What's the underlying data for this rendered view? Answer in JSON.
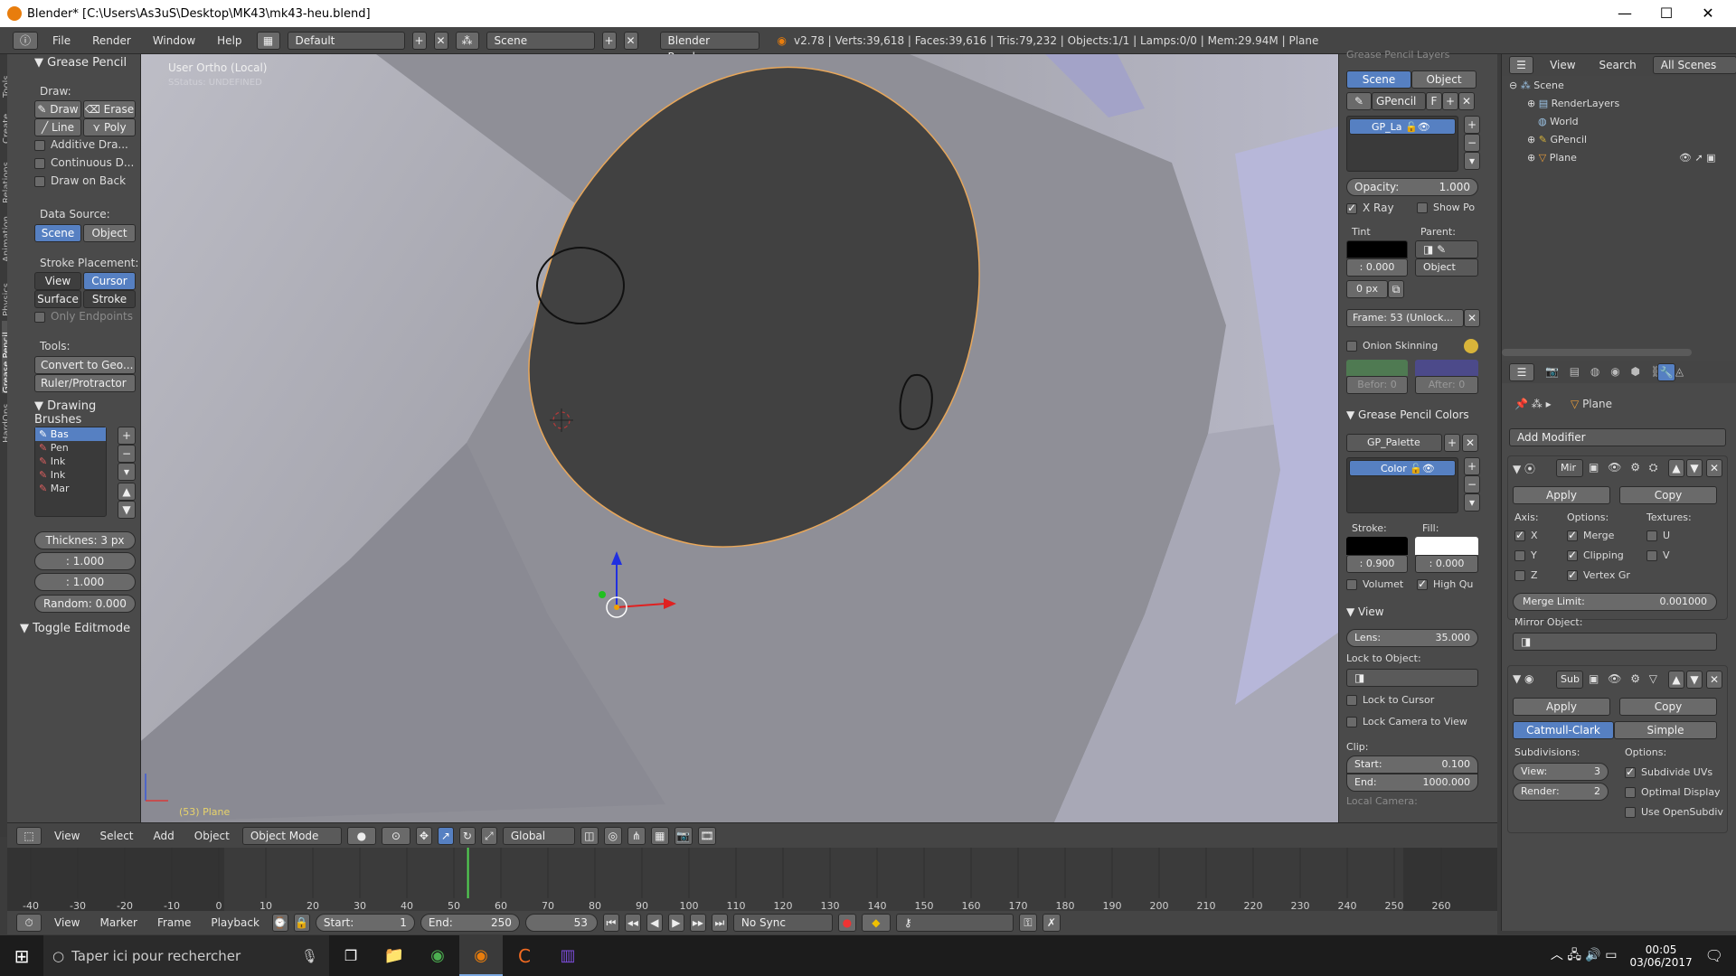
{
  "window": {
    "title": "Blender* [C:\\Users\\As3uS\\Desktop\\MK43\\mk43-heu.blend]",
    "minimize": "—",
    "maximize": "☐",
    "close": "✕"
  },
  "infobar": {
    "menus": [
      "File",
      "Render",
      "Window",
      "Help"
    ],
    "layout": "Default",
    "scene": "Scene",
    "engine": "Blender Render",
    "stats": "v2.78 | Verts:39,618 | Faces:39,616 | Tris:79,232 | Objects:1/1 | Lamps:0/0 | Mem:29.94M | Plane"
  },
  "tool_tabs": [
    "Tools",
    "Create",
    "Relations",
    "Animation",
    "Physics",
    "Grease Pencil",
    "HardOps"
  ],
  "toolshelf": {
    "panel_title": "Grease Pencil",
    "draw_label": "Draw:",
    "draw": "Draw",
    "erase": "Erase",
    "line": "Line",
    "poly": "Poly",
    "additive": "Additive Dra...",
    "continuous": "Continuous D...",
    "draw_on_back": "Draw on Back",
    "data_source_label": "Data Source:",
    "ds_scene": "Scene",
    "ds_object": "Object",
    "stroke_placement_label": "Stroke Placement:",
    "sp_view": "View",
    "sp_cursor": "Cursor",
    "sp_surface": "Surface",
    "sp_stroke": "Stroke",
    "only_endpoints": "Only Endpoints",
    "tools_label": "Tools:",
    "convert": "Convert to Geo...",
    "ruler": "Ruler/Protractor",
    "brushes_title": "Drawing Brushes",
    "brushes": [
      "Bas",
      "Pen",
      "Ink",
      "Ink",
      "Mar"
    ],
    "thickness": "Thicknes: 3 px",
    "strength1": ": 1.000",
    "strength2": ": 1.000",
    "random": "Random: 0.000",
    "toggle_editmode": "Toggle Editmode"
  },
  "viewport": {
    "view_name": "User Ortho (Local)",
    "status": "SStatus: UNDEFINED",
    "object_label": "(53) Plane"
  },
  "npanel": {
    "layers_title": "Grease Pencil Layers",
    "scene": "Scene",
    "object": "Object",
    "gpencil": "GPencil",
    "f": "F",
    "layer": "GP_La",
    "opacity": "Opacity:",
    "opacity_val": "1.000",
    "xray": "X Ray",
    "show_po": "Show Po",
    "tint": "Tint",
    "parent": "Parent:",
    "tint_val": ": 0.000",
    "parent_type": "Object",
    "px": "0 px",
    "frame": "Frame: 53 (Unlock...",
    "onion": "Onion Skinning",
    "before": "Befor: 0",
    "after": "After: 0",
    "colors_title": "Grease Pencil Colors",
    "palette": "GP_Palette",
    "color": "Color",
    "stroke": "Stroke:",
    "fill": "Fill:",
    "stroke_val": ": 0.900",
    "fill_val": ": 0.000",
    "volumet": "Volumet",
    "high_qu": "High Qu",
    "view_title": "View",
    "lens": "Lens:",
    "lens_val": "35.000",
    "lock_obj": "Lock to Object:",
    "lock_cursor": "Lock to Cursor",
    "lock_camera": "Lock Camera to View",
    "clip": "Clip:",
    "clip_start": "Start:",
    "clip_start_val": "0.100",
    "clip_end": "End:",
    "clip_end_val": "1000.000",
    "local_camera": "Local Camera:"
  },
  "outliner": {
    "view": "View",
    "search": "Search",
    "all_scenes": "All Scenes",
    "items": [
      "Scene",
      "RenderLayers",
      "World",
      "GPencil",
      "Plane"
    ]
  },
  "props": {
    "object_name": "Plane",
    "add_modifier": "Add Modifier",
    "mirror_name": "Mir",
    "apply": "Apply",
    "copy": "Copy",
    "axis": "Axis:",
    "options": "Options:",
    "textures": "Textures:",
    "x": "X",
    "y": "Y",
    "z": "Z",
    "merge": "Merge",
    "clipping": "Clipping",
    "vertex_gr": "Vertex Gr",
    "u": "U",
    "v": "V",
    "merge_limit": "Merge Limit:",
    "merge_limit_val": "0.001000",
    "mirror_object": "Mirror Object:",
    "subsurf_name": "Sub",
    "catmull": "Catmull-Clark",
    "simple": "Simple",
    "subdivisions": "Subdivisions:",
    "view_label": "View:",
    "view_val": "3",
    "render_label": "Render:",
    "render_val": "2",
    "subdivide_uvs": "Subdivide UVs",
    "optimal_display": "Optimal Display",
    "use_opensubdiv": "Use OpenSubdiv"
  },
  "vpheader": {
    "menus": [
      "View",
      "Select",
      "Add",
      "Object"
    ],
    "mode": "Object Mode",
    "orientation": "Global"
  },
  "timeline": {
    "ticks": [
      "-40",
      "-30",
      "-20",
      "-10",
      "0",
      "10",
      "20",
      "30",
      "40",
      "50",
      "60",
      "70",
      "80",
      "90",
      "100",
      "110",
      "120",
      "130",
      "140",
      "150",
      "160",
      "170",
      "180",
      "190",
      "200",
      "210",
      "220",
      "230",
      "240",
      "250",
      "260"
    ],
    "current_frame": 53,
    "menus": [
      "View",
      "Marker",
      "Frame",
      "Playback"
    ],
    "start": "Start:",
    "start_val": "1",
    "end": "End:",
    "end_val": "250",
    "frame_val": "53",
    "sync": "No Sync"
  },
  "taskbar": {
    "search": "Taper ici pour rechercher",
    "time": "00:05",
    "date": "03/06/2017"
  }
}
